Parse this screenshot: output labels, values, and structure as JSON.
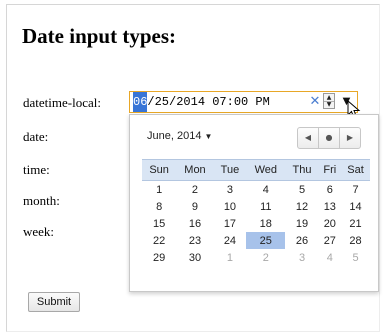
{
  "page": {
    "title": "Date input types:"
  },
  "form": {
    "labels": {
      "datetime_local": "datetime-local:",
      "date": "date:",
      "time": "time:",
      "month": "month:",
      "week": "week:"
    },
    "datetime_input": {
      "month": "06",
      "rest": "/25/2014 07:00 PM"
    },
    "icons": {
      "clear": "close-icon",
      "spin_up": "spin-up-icon",
      "spin_down": "spin-down-icon",
      "dropdown": "triangle-down-icon"
    },
    "submit_label": "Submit"
  },
  "calendar": {
    "month_label": "June, 2014",
    "weekdays": [
      "Sun",
      "Mon",
      "Tue",
      "Wed",
      "Thu",
      "Fri",
      "Sat"
    ],
    "weeks": [
      [
        {
          "d": "1"
        },
        {
          "d": "2"
        },
        {
          "d": "3"
        },
        {
          "d": "4"
        },
        {
          "d": "5"
        },
        {
          "d": "6"
        },
        {
          "d": "7"
        }
      ],
      [
        {
          "d": "8"
        },
        {
          "d": "9"
        },
        {
          "d": "10"
        },
        {
          "d": "11"
        },
        {
          "d": "12"
        },
        {
          "d": "13"
        },
        {
          "d": "14"
        }
      ],
      [
        {
          "d": "15"
        },
        {
          "d": "16"
        },
        {
          "d": "17"
        },
        {
          "d": "18"
        },
        {
          "d": "19"
        },
        {
          "d": "20"
        },
        {
          "d": "21"
        }
      ],
      [
        {
          "d": "22"
        },
        {
          "d": "23"
        },
        {
          "d": "24"
        },
        {
          "d": "25",
          "selected": true
        },
        {
          "d": "26"
        },
        {
          "d": "27"
        },
        {
          "d": "28"
        }
      ],
      [
        {
          "d": "29"
        },
        {
          "d": "30"
        },
        {
          "d": "1",
          "other": true
        },
        {
          "d": "2",
          "other": true
        },
        {
          "d": "3",
          "other": true
        },
        {
          "d": "4",
          "other": true
        },
        {
          "d": "5",
          "other": true
        }
      ]
    ],
    "selected_day": "25"
  },
  "colors": {
    "focus_border": "#e8a727",
    "selection": "#3875d7",
    "header_bg": "#d9e5f4",
    "selected_cell": "#a7c2ea"
  }
}
